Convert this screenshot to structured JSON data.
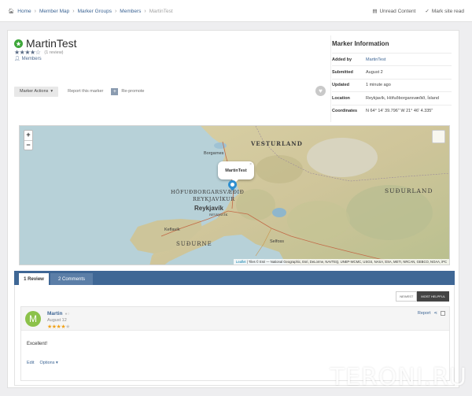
{
  "breadcrumb": {
    "items": [
      "Home",
      "Member Map",
      "Marker Groups",
      "Members",
      "MartinTest"
    ]
  },
  "top_actions": {
    "unread": "Unread Content",
    "mark_read": "Mark site read"
  },
  "marker": {
    "title": "MartinTest",
    "rating_stars": 4,
    "rating_max": 5,
    "review_count": "(1 review)",
    "group": "Members",
    "actions_label": "Marker Actions",
    "report_label": "Report this marker",
    "promote_label": "Re-promote"
  },
  "info": {
    "title": "Marker Information",
    "rows": [
      {
        "key": "Added by",
        "value": "MartinTest"
      },
      {
        "key": "Submitted",
        "value": "August 2"
      },
      {
        "key": "Updated",
        "value": "1 minute ago"
      },
      {
        "key": "Location",
        "value": "Reykjavík, Höfuðborgarsvæðið, Ísland"
      },
      {
        "key": "Coordinates",
        "value": "N 64° 14' 39.796\"   W 21° 46' 4.335\""
      }
    ]
  },
  "map": {
    "zoom_in": "+",
    "zoom_out": "−",
    "popup_title": "MartinTest",
    "popup_close": "×",
    "labels": {
      "vesturland": "VESTURLAND",
      "sudurland": "SUÐURLAND",
      "sudurne": "SUÐURNE",
      "hofudborg": "HÖFUÐBORGARSVÆÐIÐ",
      "reykjavik_caps": "REYKJAVÍKUR",
      "reykjavik": "Reykjavík",
      "reykjavik_small": "REYKJAVÍK",
      "borgarnes": "Borgarnes",
      "keflavik": "Keflavík",
      "selfoss": "Selfoss"
    },
    "attribution_link": "Leaflet",
    "attribution": " | Tiles © Esri — National Geographic, Esri, DeLorme, NAVTEQ, UNEP-WCMC, USGS, NASA, ESA, METI, NRCAN, GEBCO, NOAA, iPC"
  },
  "tabs": {
    "review": "1 Review",
    "comments": "2 Comments"
  },
  "sort": {
    "newest": "NEWEST",
    "helpful": "MOST HELPFUL"
  },
  "review": {
    "avatar_letter": "M",
    "author": "Martin",
    "date": "August 12",
    "stars": 4,
    "text": "Excellent!",
    "report": "Report",
    "edit": "Edit",
    "options": "Options"
  },
  "watermark": "TERONI.RU",
  "colors": {
    "accent": "#3f6795",
    "star_review": "#f0a21b",
    "avatar": "#8cc24a",
    "pin": "#2e8fd0"
  }
}
